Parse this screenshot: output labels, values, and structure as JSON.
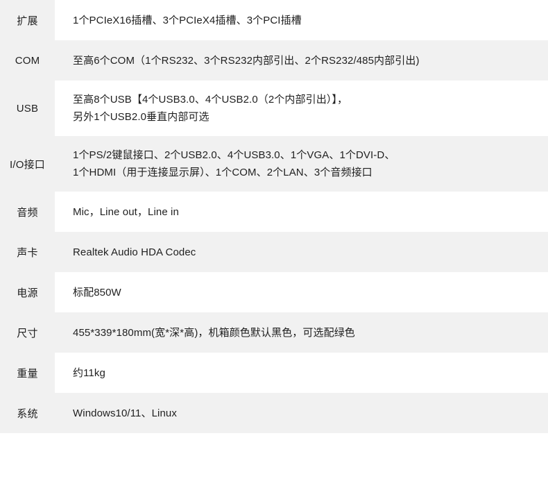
{
  "table": {
    "colors": {
      "stripe_gray": "#f1f1f1",
      "stripe_white": "#ffffff",
      "text": "#1f1f1f",
      "page_background": "#ffffff"
    },
    "rows": [
      {
        "label": "扩展",
        "lines": [
          "1个PCIeX16插槽、3个PCIeX4插槽、3个PCI插槽"
        ],
        "striped": false
      },
      {
        "label": "COM",
        "lines": [
          "至高6个COM（1个RS232、3个RS232内部引出、2个RS232/485内部引出)"
        ],
        "striped": true
      },
      {
        "label": "USB",
        "lines": [
          "至高8个USB【4个USB3.0、4个USB2.0（2个内部引出）】，",
          "另外1个USB2.0垂直内部可选"
        ],
        "striped": false
      },
      {
        "label": "I/O接口",
        "lines": [
          "1个PS/2键鼠接口、2个USB2.0、4个USB3.0、1个VGA、1个DVI-D、",
          "1个HDMI（用于连接显示屏）、1个COM、2个LAN、3个音频接口"
        ],
        "striped": true
      },
      {
        "label": "音频",
        "lines": [
          "Mic，Line out，Line in"
        ],
        "striped": false
      },
      {
        "label": "声卡",
        "lines": [
          "Realtek Audio HDA Codec"
        ],
        "striped": true
      },
      {
        "label": "电源",
        "lines": [
          "标配850W"
        ],
        "striped": false
      },
      {
        "label": "尺寸",
        "lines": [
          "455*339*180mm(宽*深*高)，机箱颜色默认黑色，可选配绿色"
        ],
        "striped": true
      },
      {
        "label": "重量",
        "lines": [
          "约11kg"
        ],
        "striped": false
      },
      {
        "label": "系统",
        "lines": [
          "Windows10/11、Linux"
        ],
        "striped": true
      }
    ]
  }
}
